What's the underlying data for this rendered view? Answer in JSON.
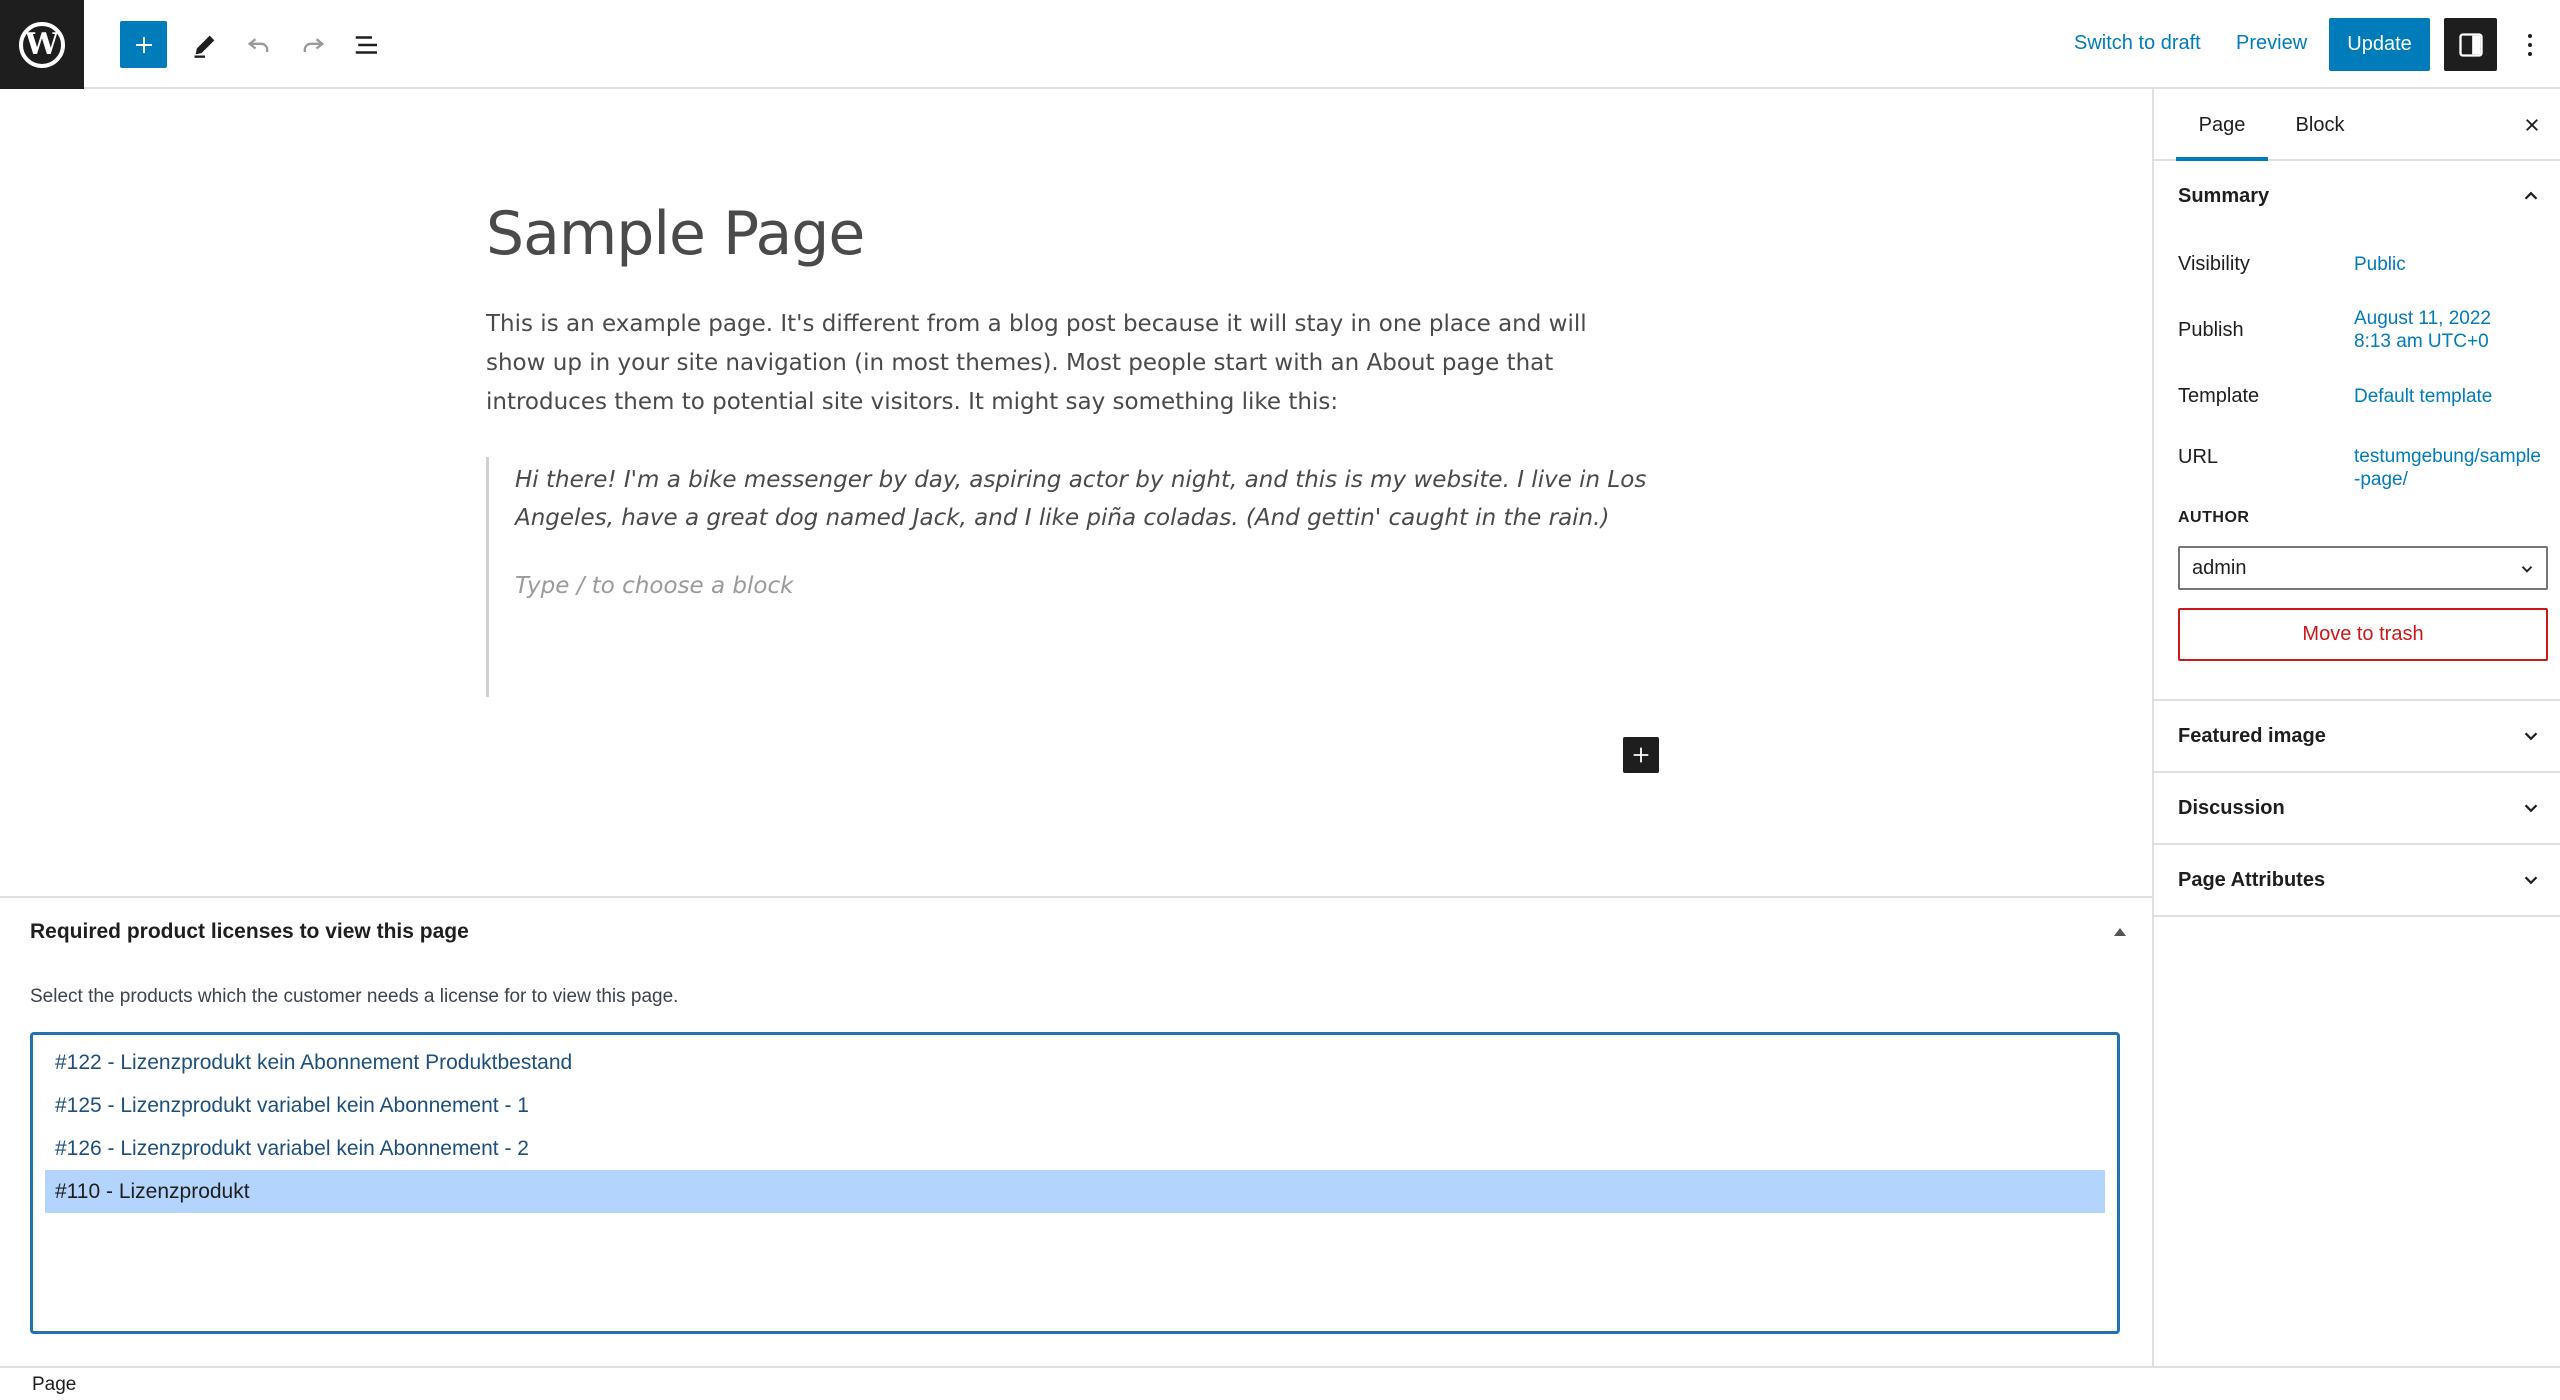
{
  "toolbar": {
    "logo_letter": "W",
    "switch_to_draft": "Switch to draft",
    "preview": "Preview",
    "update": "Update",
    "icons": [
      "wordpress-logo",
      "plus-icon",
      "pencil-icon",
      "undo-icon",
      "redo-icon",
      "list-view-icon",
      "sidebar-toggle-icon",
      "more-vertical-icon"
    ]
  },
  "editor": {
    "title": "Sample Page",
    "paragraph": "This is an example page. It's different from a blog post because it will stay in one place and will show up in your site navigation (in most themes). Most people start with an About page that introduces them to potential site visitors. It might say something like this:",
    "quote": "Hi there! I'm a bike messenger by day, aspiring actor by night, and this is my website. I live in Los Angeles, have a great dog named Jack, and I like piña coladas. (And gettin' caught in the rain.)",
    "block_placeholder": "Type / to choose a block"
  },
  "metabox": {
    "title": "Required product licenses to view this page",
    "description": "Select the products which the customer needs a license for to view this page.",
    "options": [
      {
        "label": "#122 - Lizenzprodukt kein Abonnement Produktbestand",
        "selected": false
      },
      {
        "label": "#125 - Lizenzprodukt variabel kein Abonnement - 1",
        "selected": false
      },
      {
        "label": "#126 - Lizenzprodukt variabel kein Abonnement - 2",
        "selected": false
      },
      {
        "label": "#110 - Lizenzprodukt",
        "selected": true
      }
    ]
  },
  "footer": {
    "breadcrumb": "Page"
  },
  "sidebar": {
    "tabs": [
      {
        "label": "Page",
        "active": true
      },
      {
        "label": "Block",
        "active": false
      }
    ],
    "summary": {
      "heading": "Summary",
      "visibility_label": "Visibility",
      "visibility_value": "Public",
      "publish_label": "Publish",
      "publish_value_line1": "August 11, 2022",
      "publish_value_line2": "8:13 am UTC+0",
      "template_label": "Template",
      "template_value": "Default template",
      "url_label": "URL",
      "url_value": "testumgebung/sample-page/",
      "author_label": "AUTHOR",
      "author_value": "admin",
      "trash_label": "Move to trash"
    },
    "panels": [
      {
        "label": "Featured image"
      },
      {
        "label": "Discussion"
      },
      {
        "label": "Page Attributes"
      }
    ]
  },
  "colors": {
    "accent": "#007cba",
    "danger": "#cc1818",
    "dark": "#1e1e1e",
    "selection": "#b3d4fc"
  }
}
